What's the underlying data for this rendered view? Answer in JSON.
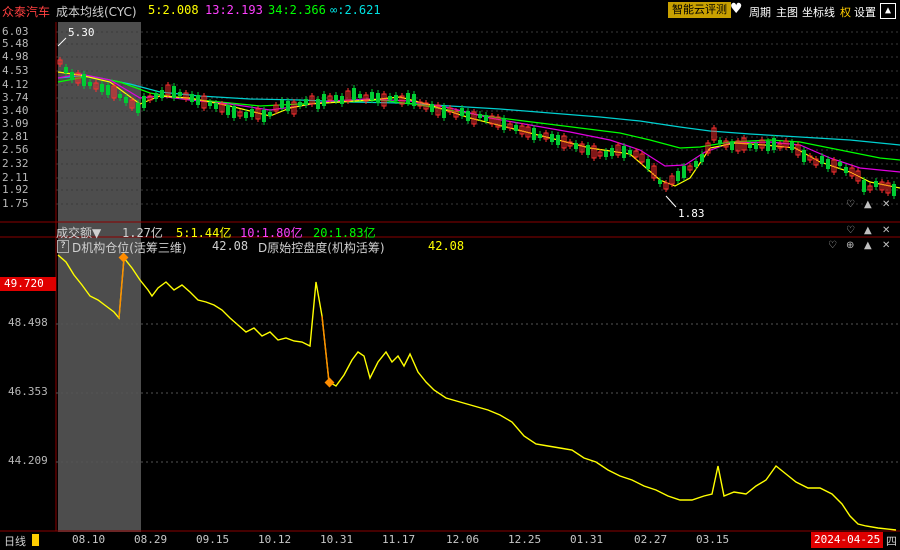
{
  "header": {
    "stock_name": "众泰汽车",
    "indicator_name": "成本均线(CYC)",
    "ma5": "5:2.008",
    "ma13": "13:2.193",
    "ma34": "34:2.366",
    "ma_inf": "∞:2.621",
    "cloud_button": "智能云评测",
    "menu_period": "周期",
    "menu_chart": "主图",
    "menu_axis": "坐标线",
    "menu_rights": "权",
    "menu_settings": "设置"
  },
  "price_axis": {
    "ticks": [
      "6.03",
      "5.48",
      "4.98",
      "4.53",
      "4.12",
      "3.74",
      "3.40",
      "3.09",
      "2.81",
      "2.56",
      "2.32",
      "2.11",
      "1.92",
      "1.75"
    ],
    "annotations": {
      "high": "5.30",
      "low": "1.83"
    }
  },
  "volume_panel": {
    "label": "成交额",
    "total": "1.27亿",
    "ma5": "5:1.44亿",
    "ma10": "10:1.80亿",
    "ma20": "20:1.83亿"
  },
  "indicator_panel": {
    "help_icon": "?",
    "label1": "D机构仓位(活筹三维)",
    "value1": "42.08",
    "label2": "D原始控盘度(机构活筹)",
    "value2": "42.08",
    "current_value": "49.720",
    "ticks": [
      "48.498",
      "46.353",
      "44.209"
    ]
  },
  "bottom_bar": {
    "period": "日线",
    "dates": [
      "08.10",
      "08.29",
      "09.15",
      "10.12",
      "10.31",
      "11.17",
      "12.06",
      "12.25",
      "01.31",
      "02.27",
      "03.15"
    ],
    "current_date": "2024-04-25",
    "weekday": "四"
  },
  "colors": {
    "ma5": "#ffff00",
    "ma13": "#e000e0",
    "ma34": "#00ff00",
    "ma_inf": "#00e0e0",
    "up": "#ff3030",
    "down": "#00cc33",
    "highlight": "#555555",
    "indicator": "#ffff00",
    "signal": "#ff8c00"
  },
  "chart_data": {
    "type": "line",
    "title": "D机构仓位(活筹三维)",
    "x": [
      "08.10",
      "08.29",
      "09.15",
      "10.12",
      "10.31",
      "11.17",
      "12.06",
      "12.25",
      "01.31",
      "02.27",
      "03.15",
      "2024-04-25"
    ],
    "series": [
      {
        "name": "D机构仓位(活筹三维)",
        "values": [
          50.3,
          49.7,
          48.9,
          48.5,
          49.0,
          47.4,
          45.9,
          45.3,
          44.6,
          43.6,
          44.2,
          42.08
        ]
      }
    ],
    "ylim": [
      42.0,
      50.5
    ]
  }
}
